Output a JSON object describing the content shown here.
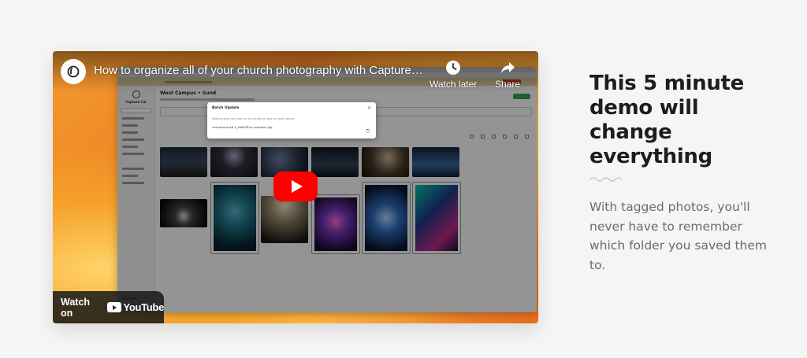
{
  "video": {
    "title": "How to organize all of your church photography with Capture Calvary",
    "watch_later_label": "Watch later",
    "share_label": "Share",
    "watch_on_label": "Watch on",
    "youtube_label": "YouTube",
    "app_preview": {
      "brand": "Capture Cal",
      "page_title": "West Campus • Sund",
      "modal": {
        "title": "Batch Update",
        "close": "×",
        "description": "Adding tags will add to the existing tags on each asset.",
        "file": "mumenb-syed-4_hWuPR2o-unsplash.jpg"
      }
    }
  },
  "section": {
    "headline": "This 5 minute demo will change everything",
    "body": "With tagged photos, you'll never have to remember which folder you saved them to."
  },
  "colors": {
    "play_button": "#ff0000",
    "headline": "#1d1d1d",
    "body": "#6b6b6b",
    "accent_squiggle": "#c9ccd1"
  }
}
